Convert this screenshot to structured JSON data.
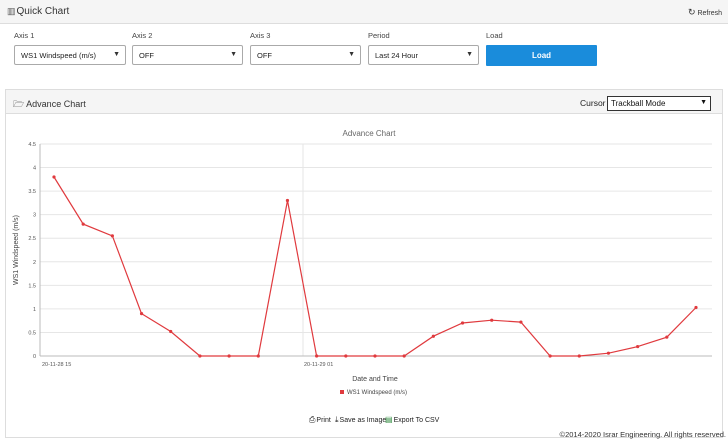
{
  "header": {
    "title": "Quick Chart",
    "refresh_label": "Refresh"
  },
  "controls": {
    "axis1": {
      "label": "Axis 1",
      "value": "WS1 Windspeed (m/s)"
    },
    "axis2": {
      "label": "Axis 2",
      "value": "OFF"
    },
    "axis3": {
      "label": "Axis 3",
      "value": "OFF"
    },
    "period": {
      "label": "Period",
      "value": "Last 24 Hour"
    },
    "load": {
      "label": "Load",
      "button": "Load"
    }
  },
  "panel": {
    "title": "Advance Chart",
    "cursor_label": "Cursor",
    "cursor_value": "Trackball Mode"
  },
  "actions": {
    "print": "Print",
    "save": "Save as Image",
    "export": "Export To CSV"
  },
  "footer": "©2014-2020 Israr Engineering. All rights reserved.",
  "colors": {
    "series": "#e03a3e",
    "button": "#1a8cdb",
    "panel_bg": "#f5f5f5"
  },
  "icons": {
    "title": "bar-chart-icon",
    "refresh": "refresh-icon",
    "panel": "folder-open-icon",
    "print": "print-icon",
    "save": "download-icon",
    "export": "csv-icon"
  },
  "chart_data": {
    "type": "line",
    "title": "Advance Chart",
    "xlabel": "Date and Time",
    "ylabel": "WS1 Windspeed (m/s)",
    "ylim": [
      0,
      4.5
    ],
    "yticks": [
      "0",
      "0.5",
      "1",
      "1.5",
      "2",
      "2.5",
      "3",
      "3.5",
      "4",
      "4.5"
    ],
    "xtick_labels": [
      "20-11-28 15",
      "20-11-29 01"
    ],
    "grid": true,
    "legend_position": "bottom",
    "series": [
      {
        "name": "WS1 Windspeed (m/s)",
        "values": [
          3.8,
          2.8,
          2.55,
          0.9,
          0.52,
          0,
          0,
          0,
          3.3,
          0,
          0,
          0,
          0,
          0.42,
          0.7,
          0.76,
          0.72,
          0,
          0,
          0.06,
          0.2,
          0.4,
          1.03
        ]
      }
    ]
  }
}
